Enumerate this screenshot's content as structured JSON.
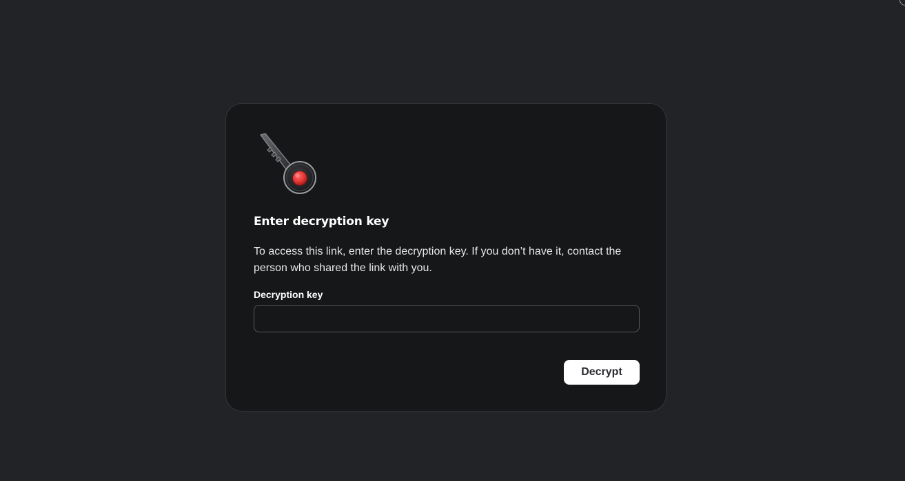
{
  "dialog": {
    "title": "Enter decryption key",
    "description": "To access this link, enter the decryption key. If you don’t have it, contact the person who shared the link with you.",
    "field_label": "Decryption key",
    "input_value": "",
    "button_label": "Decrypt",
    "illustration_icon": "key-icon"
  },
  "colors": {
    "page_background": "#222326",
    "card_background": "#161718",
    "accent_red": "#e53935",
    "button_background": "#ffffff"
  }
}
